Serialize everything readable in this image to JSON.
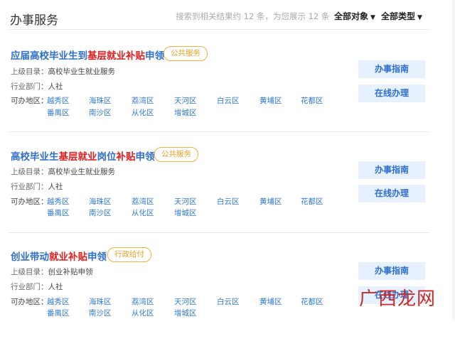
{
  "header": {
    "title": "办事服务",
    "summary": "搜索到相关结果约 12 条，为您展示 12 条",
    "filter_object": "全部对象",
    "filter_type": "全部类型"
  },
  "meta_labels": {
    "parent": "上级目录：",
    "dept": "行业部门：",
    "area": "可办地区："
  },
  "buttons": {
    "guide": "办事指南",
    "online": "在线办理"
  },
  "cards": [
    {
      "title_parts": [
        "应届高校毕业生到",
        "基层就业补贴",
        "申领"
      ],
      "tag": "公共服务",
      "parent": "高校毕业生就业服务",
      "dept": "人社",
      "districts": [
        "越秀区",
        "海珠区",
        "荔湾区",
        "天河区",
        "白云区",
        "黄埔区",
        "花都区",
        "番禺区",
        "南沙区",
        "从化区",
        "增城区"
      ]
    },
    {
      "title_parts": [
        "高校毕业生",
        "基层就业",
        "岗位",
        "补贴",
        "申领"
      ],
      "tag": "公共服务",
      "parent": "高校毕业生就业服务",
      "dept": "人社",
      "districts": [
        "越秀区",
        "海珠区",
        "荔湾区",
        "天河区",
        "白云区",
        "黄埔区",
        "花都区",
        "番禺区",
        "南沙区",
        "从化区",
        "增城区"
      ]
    },
    {
      "title_parts": [
        "创业带动",
        "就业补贴",
        "申领"
      ],
      "tag": "行政给付",
      "parent": "创业补贴申领",
      "dept": "人社",
      "districts": [
        "越秀区",
        "海珠区",
        "荔湾区",
        "天河区",
        "白云区",
        "黄埔区",
        "花都区",
        "番禺区",
        "南沙区",
        "从化区",
        "增城区"
      ]
    }
  ],
  "watermark": "广西龙网",
  "icons": {
    "chevron": "chevron-down-icon"
  }
}
